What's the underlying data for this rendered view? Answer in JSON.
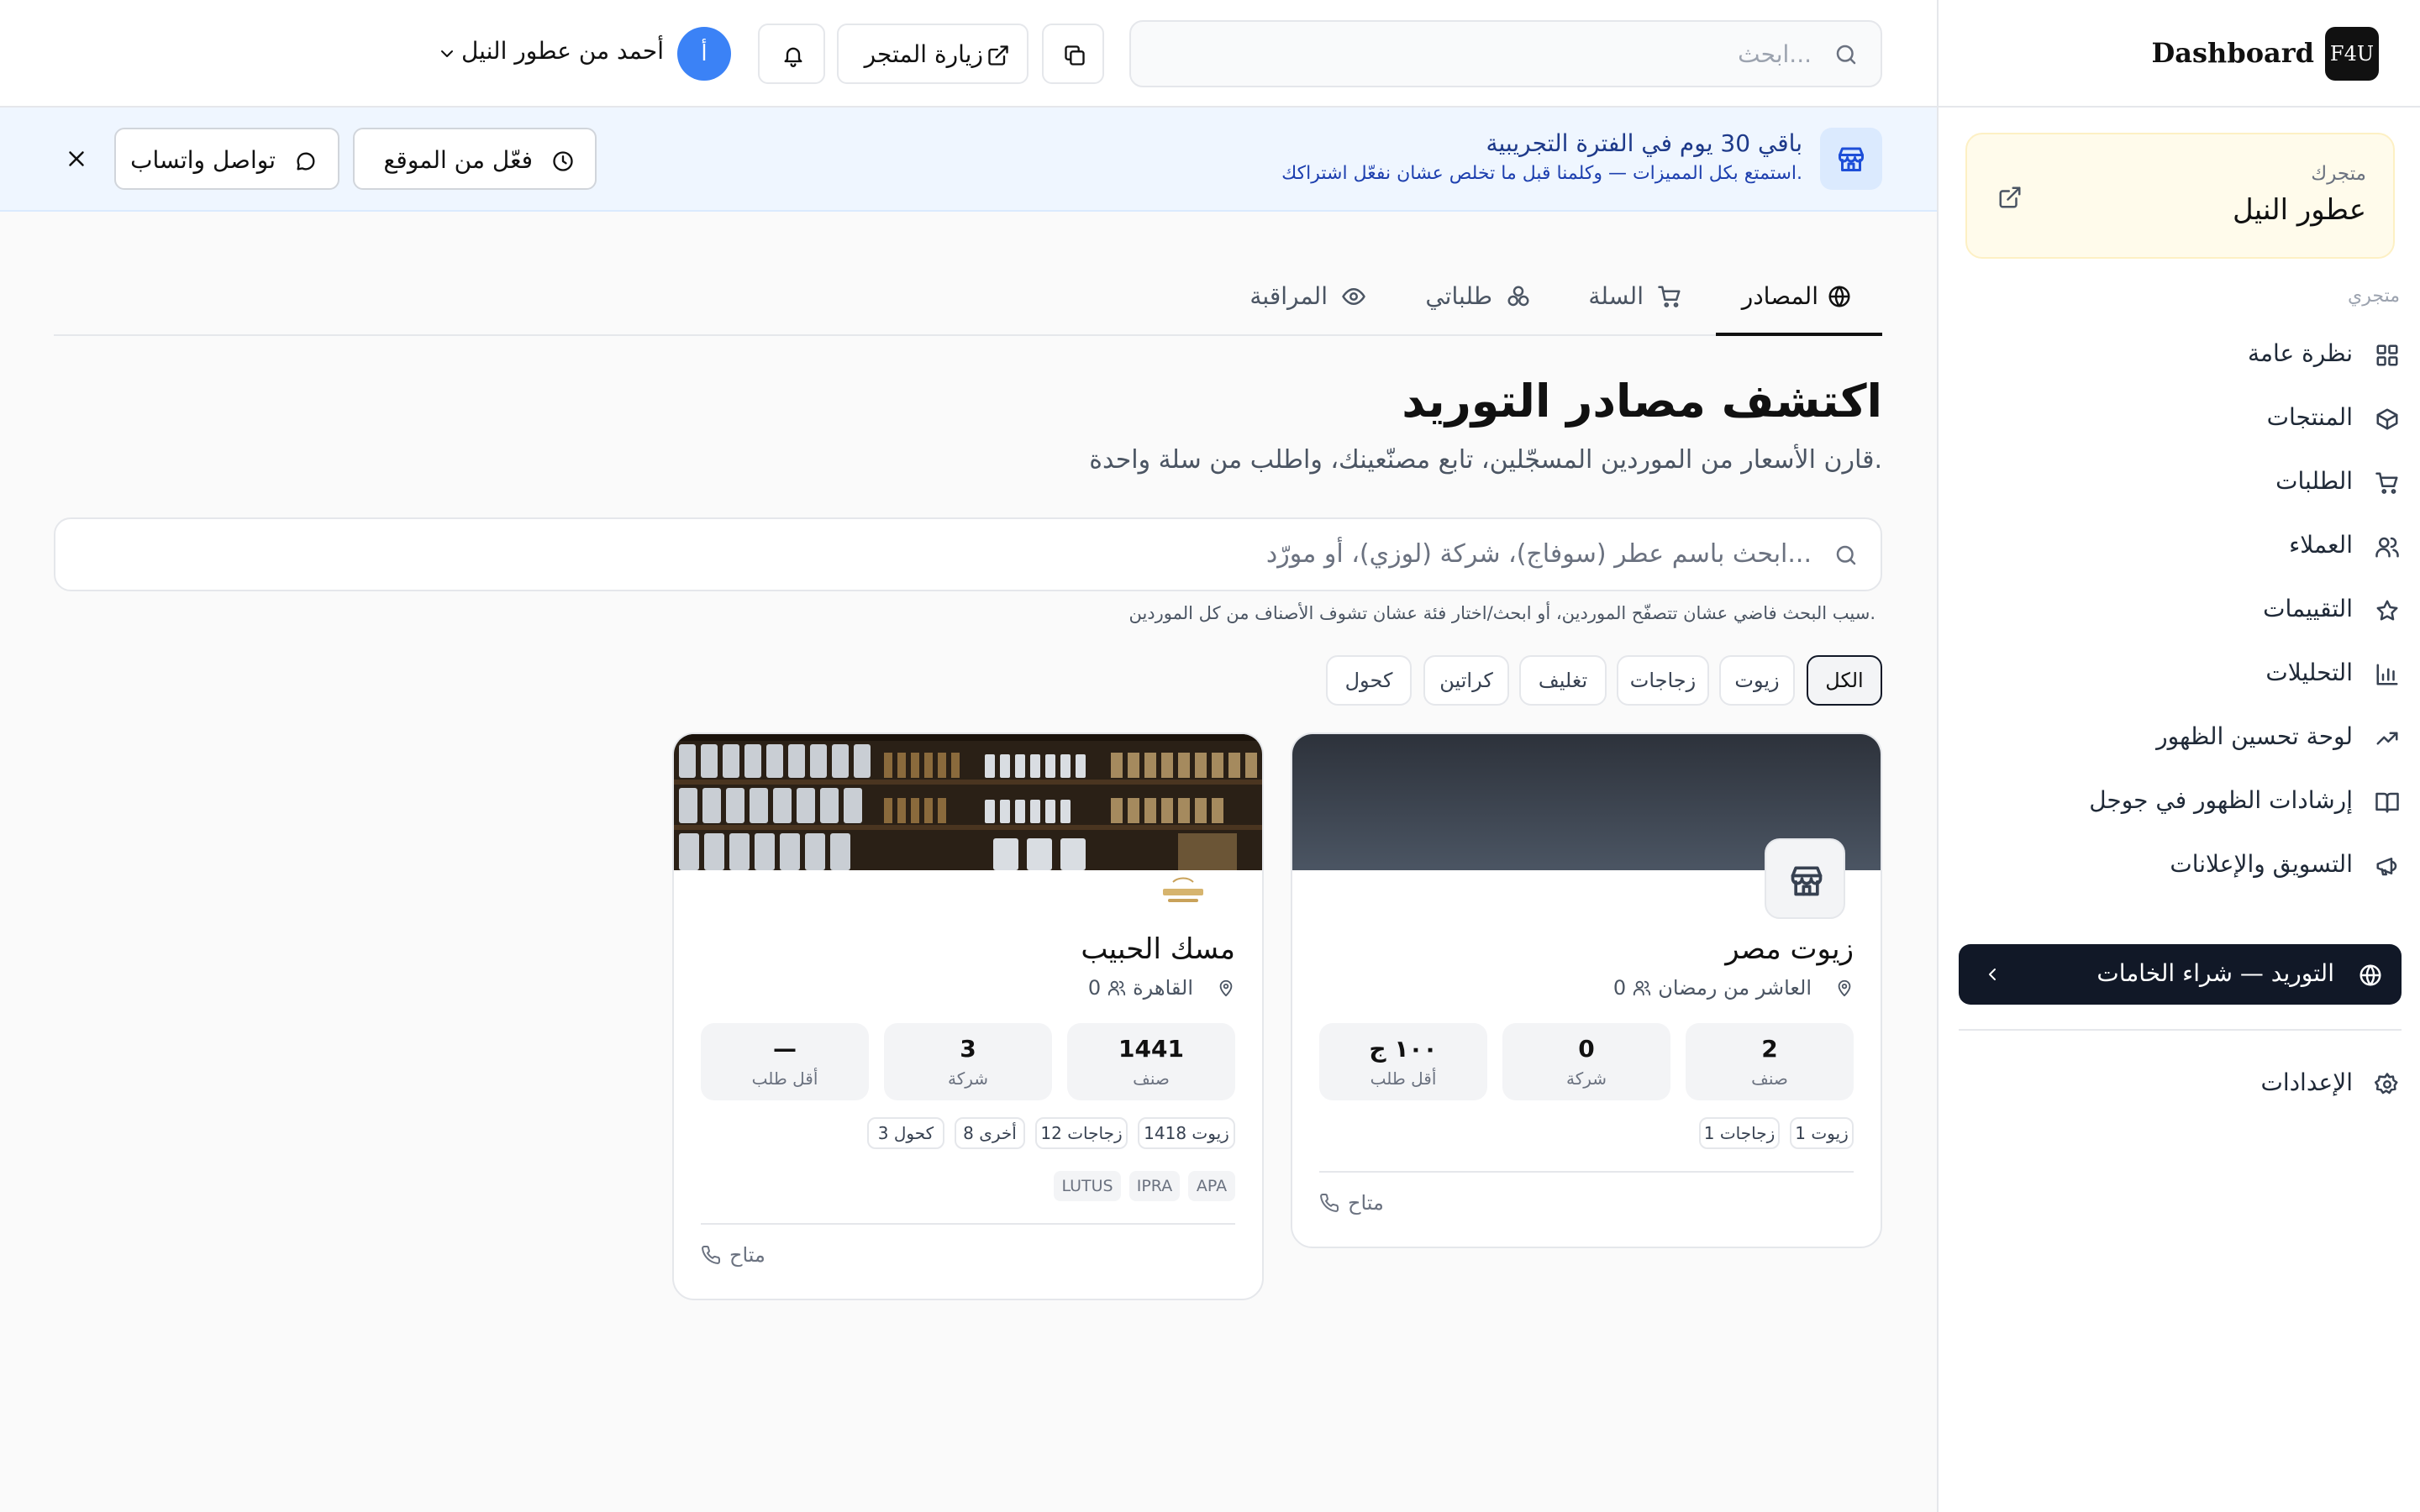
{
  "app": {
    "logo": "F4U",
    "brand": "Dashboard"
  },
  "store": {
    "caption": "متجرك",
    "name": "عطور النيل"
  },
  "sidebar": {
    "section_label": "متجري",
    "items": [
      {
        "label": "نظرة عامة",
        "icon": "grid-icon"
      },
      {
        "label": "المنتجات",
        "icon": "box-icon"
      },
      {
        "label": "الطلبات",
        "icon": "cart-icon"
      },
      {
        "label": "العملاء",
        "icon": "users-icon"
      },
      {
        "label": "التقييمات",
        "icon": "star-icon"
      },
      {
        "label": "التحليلات",
        "icon": "bar-chart-icon"
      },
      {
        "label": "لوحة تحسين الظهور",
        "icon": "trend-icon"
      },
      {
        "label": "إرشادات الظهور في جوجل",
        "icon": "book-icon"
      },
      {
        "label": "التسويق والإعلانات",
        "icon": "megaphone-icon"
      }
    ],
    "active": {
      "label": "التوريد — شراء الخامات",
      "icon": "globe-icon"
    },
    "settings": {
      "label": "الإعدادات",
      "icon": "gear-icon"
    }
  },
  "topbar": {
    "search_placeholder": "ابحث...",
    "visit_label": "زيارة المتجر",
    "avatar_letter": "أ",
    "user_name": "أحمد من عطور النيل"
  },
  "banner": {
    "title": "باقي 30 يوم في الفترة التجريبية",
    "subtitle": "استمتع بكل المميزات — وكلمنا قبل ما تخلص عشان نفعّل اشتراكك.",
    "activate_label": "فعّل من الموقع",
    "whatsapp_label": "تواصل واتساب"
  },
  "tabs": [
    "المصادر",
    "السلة",
    "طلباتي",
    "المراقبة"
  ],
  "page": {
    "title": "اكتشف مصادر التوريد",
    "subtitle": "قارن الأسعار من الموردين المسجّلين، تابع مصنّعينك، واطلب من سلة واحدة.",
    "search_placeholder": "ابحث باسم عطر (سوفاج)، شركة (لوزي)، أو مورّد...",
    "hint": "سيب البحث فاضي عشان تتصفّح الموردين، أو ابحث/اختار فئة عشان تشوف الأصناف من كل الموردين."
  },
  "chips": [
    "الكل",
    "زيوت",
    "زجاجات",
    "تغليف",
    "كراتين",
    "كحول"
  ],
  "suppliers": [
    {
      "name": "زيوت مصر",
      "location": "العاشر من رمضان",
      "followers": "0",
      "stats": [
        {
          "value": "2",
          "label": "صنف"
        },
        {
          "value": "0",
          "label": "شركة"
        },
        {
          "value": "١٠٠ ج",
          "label": "أقل طلب"
        }
      ],
      "tags": [
        "زيوت 1",
        "زجاجات 1"
      ],
      "brands": [],
      "status": "متاح"
    },
    {
      "name": "مسك الحبيب",
      "location": "القاهرة",
      "followers": "0",
      "logo_text": "مسك الحبيب",
      "stats": [
        {
          "value": "1441",
          "label": "صنف"
        },
        {
          "value": "3",
          "label": "شركة"
        },
        {
          "value": "—",
          "label": "أقل طلب"
        }
      ],
      "tags": [
        "زيوت 1418",
        "زجاجات 12",
        "أخرى 8",
        "كحول 3"
      ],
      "brands": [
        "APA",
        "IPRA",
        "LUTUS"
      ],
      "status": "متاح"
    }
  ],
  "colors": {
    "accent": "#111827",
    "banner_bg": "#eff6ff",
    "avatar": "#3b82f6",
    "store_card": "#fffbeb"
  }
}
